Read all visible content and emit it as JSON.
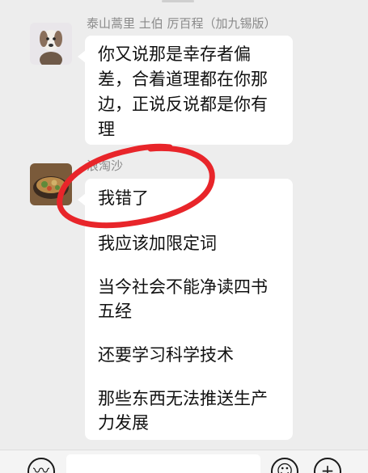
{
  "chat": {
    "messages": [
      {
        "sender": "泰山蒿里 土伯 厉百程（加九锡版）",
        "avatar": "dog-avatar",
        "lines": [
          "你又说那是幸存者偏",
          "差，合着道理都在你那",
          "边，正说反说都是你有",
          "理"
        ]
      },
      {
        "sender": "浪淘沙",
        "avatar": "food-bowl-avatar",
        "lines": [
          "我错了",
          "我应该加限定词",
          "当今社会不能净读四书",
          "五经",
          "还要学习科学技术",
          "那些东西无法推送生产",
          "力发展"
        ]
      }
    ],
    "annotation": {
      "type": "hand-drawn red circle",
      "color": "#e8252a",
      "target": "我错了"
    }
  },
  "input_bar": {
    "voice_icon": "voice-icon",
    "emoji_icon": "emoji-icon",
    "plus_icon": "plus-icon",
    "text_value": ""
  },
  "colors": {
    "background": "#ededed",
    "bubble": "#ffffff",
    "name_text": "#8a8a8a",
    "annotation": "#e8252a"
  }
}
